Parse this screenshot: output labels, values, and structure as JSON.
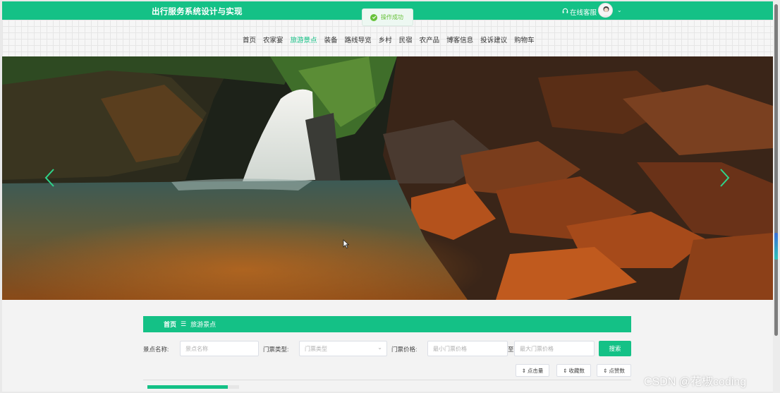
{
  "header": {
    "site_title": "出行服务系统设计与实现",
    "service_label": "在线客服",
    "service_icon": "headset-icon",
    "avatar_icon": "user-avatar-icon"
  },
  "toast": {
    "message": "操作成功",
    "icon": "success-check-icon",
    "color": "#67c23a"
  },
  "nav": {
    "items": [
      "首页",
      "农家宴",
      "旅游景点",
      "装备",
      "路线导览",
      "乡村",
      "民宿",
      "农产品",
      "博客信息",
      "投诉建议",
      "购物车"
    ],
    "active": "旅游景点"
  },
  "banner": {
    "prev_icon": "chevron-left-icon",
    "next_icon": "chevron-right-icon"
  },
  "breadcrumb": {
    "home": "首页",
    "separator": "☰",
    "current": "旅游景点"
  },
  "filters": {
    "name_label": "景点名称:",
    "name_placeholder": "景点名称",
    "ticket_type_label": "门票类型:",
    "ticket_type_placeholder": "门票类型",
    "price_label": "门票价格:",
    "min_price_placeholder": "最小门票价格",
    "to_label": "至",
    "max_price_placeholder": "最大门票价格",
    "search_label": "搜索"
  },
  "sort": {
    "clicks": "点击量",
    "favorites": "收藏数",
    "likes": "点赞数",
    "icon": "sort-icon"
  },
  "progress": {
    "fraction": 0.88
  },
  "watermark": "CSDN @花椒coding",
  "theme": {
    "accent": "#14c186"
  }
}
